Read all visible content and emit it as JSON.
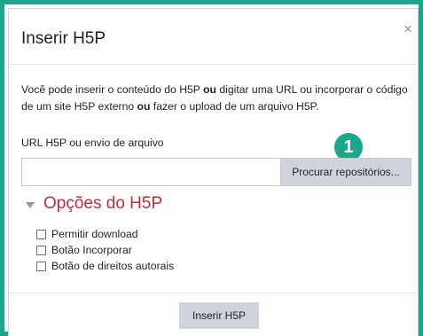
{
  "dialog": {
    "title": "Inserir H5P",
    "close_label": "×"
  },
  "intro": {
    "part1": "Você pode inserir o conteúdo do H5P ",
    "bold1": "ou",
    "part2": " digitar uma URL ou incorporar o código de um site H5P externo ",
    "bold2": "ou",
    "part3": " fazer o upload de um arquivo H5P."
  },
  "url_field": {
    "label": "URL H5P ou envio de arquivo",
    "value": "",
    "browse_button": "Procurar repositórios..."
  },
  "callout": {
    "number": "1",
    "color": "#1aa78c"
  },
  "options_section": {
    "title": "Opções do H5P",
    "options": [
      {
        "label": "Permitir download",
        "checked": false
      },
      {
        "label": "Botão Incorporar",
        "checked": false
      },
      {
        "label": "Botão de direitos autorais",
        "checked": false
      }
    ]
  },
  "footer": {
    "submit_label": "Inserir H5P"
  },
  "colors": {
    "frame": "#1aa78c",
    "section_title": "#c02d38",
    "button_bg": "#ced4da"
  }
}
